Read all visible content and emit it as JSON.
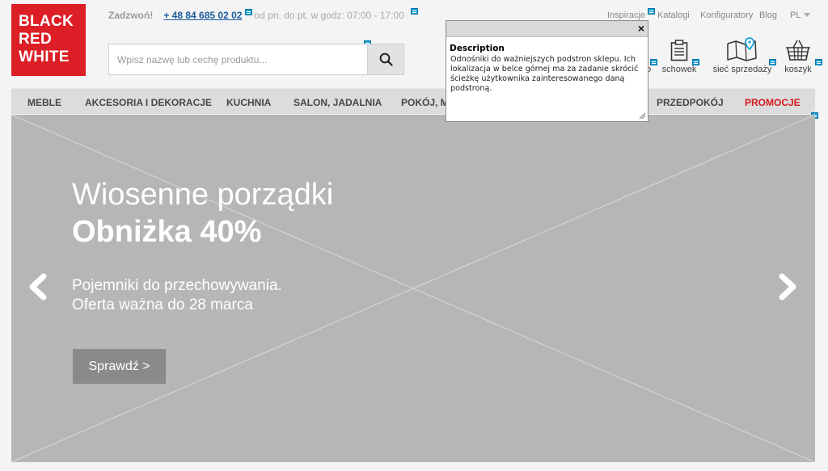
{
  "logo": {
    "lines": [
      "BLACK",
      "RED",
      "WHITE"
    ]
  },
  "contact": {
    "call_label": "Zadzwoń!",
    "phone": "+ 48 84 685 02 02",
    "hours": "od pn. do pt. w godz: 07:00 - 17:00"
  },
  "top_links": {
    "inspiracje": "Inspiracje",
    "katalogi": "Katalogi",
    "konfiguratory": "Konfiguratory",
    "blog": "Blog",
    "language": "PL"
  },
  "search": {
    "placeholder": "Wpisz nazwę lub cechę produktu...",
    "value": "",
    "button_icon": "search-icon"
  },
  "utility": {
    "partial_label": "o",
    "schowek": {
      "label": "schowek",
      "icon": "clipboard-icon"
    },
    "siec": {
      "label": "sieć sprzedaży",
      "icon": "map-pin-icon"
    },
    "koszyk": {
      "label": "koszyk",
      "icon": "basket-icon"
    }
  },
  "main_nav": [
    "MEBLE",
    "AKCESORIA I DEKORACJE",
    "KUCHNIA",
    "SALON, JADALNIA",
    "POKÓJ, M",
    "PRZEDPOKÓJ",
    "PROMOCJE"
  ],
  "hero": {
    "title": "Wiosenne porządki",
    "subtitle": "Obniżka 40%",
    "line1": "Pojemniki do przechowywania.",
    "line2": "Oferta ważna do 28 marca",
    "cta": "Sprawdź >",
    "prev_icon": "chevron-left-icon",
    "next_icon": "chevron-right-icon"
  },
  "popup": {
    "close": "×",
    "title": "Description",
    "text": "Odnośniki do ważniejszych podstron sklepu. Ich lokalizacja w belce górnej ma za zadanie skrócić ścieżkę użytkownika zainteresowanego daną podstroną."
  },
  "colors": {
    "brand_red": "#dc1f26",
    "link_blue": "#1a5a9c",
    "promo_red": "#d5181f",
    "annotation_blue": "#1f9fd6"
  }
}
